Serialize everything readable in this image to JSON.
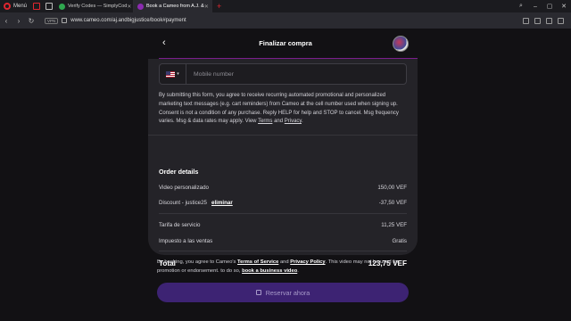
{
  "browser": {
    "menu_label": "Menú",
    "tabs": [
      {
        "title": "Verify Codes — SimplyCod",
        "active": false
      },
      {
        "title": "Book a Cameo from A.J. &",
        "active": true
      }
    ],
    "new_tab": "+",
    "vpn": "VPN",
    "url": "www.cameo.com/aj.andbigjustice/book#payment"
  },
  "header": {
    "title": "Finalizar compra",
    "back_icon": "chevron-left-icon"
  },
  "phone": {
    "placeholder": "Mobile number",
    "country": "US"
  },
  "consent": {
    "text": "By submitting this form, you agree to receive recurring automated promotional and personalized marketing text messages (e.g. cart reminders) from Cameo at the cell number used when signing up. Consent is not a condition of any purchase. Reply HELP for help and STOP to cancel. Msg frequency varies. Msg & data rates may apply. View ",
    "terms_link": "Terms",
    "and": " and ",
    "privacy_link": "Privacy",
    "end": "."
  },
  "order": {
    "title": "Order details",
    "items": [
      {
        "label": "Video personalizado",
        "value": "150,00 VEF"
      },
      {
        "label": "Discount - justice25",
        "action": "eliminar",
        "value": "-37,50 VEF"
      },
      {
        "label": "Tarifa de servicio",
        "value": "11,25 VEF"
      },
      {
        "label": "Impuesto a las ventas",
        "value": "Gratis"
      }
    ],
    "total_label": "Total",
    "total_value": "123,75 VEF"
  },
  "terms": {
    "prefix": "By booking, you agree to Cameo's ",
    "terms_link": "Terms of Service",
    "and": " and ",
    "privacy_link": "Privacy Policy",
    "middle": ". This video may not be used for promotion or endorsement. to do so, ",
    "business_link": "book a business video",
    "end": "."
  },
  "cta": {
    "label": "Reservar ahora"
  },
  "colors": {
    "accent": "#7b1e8c",
    "button": "#3d2373",
    "card": "#242328"
  }
}
